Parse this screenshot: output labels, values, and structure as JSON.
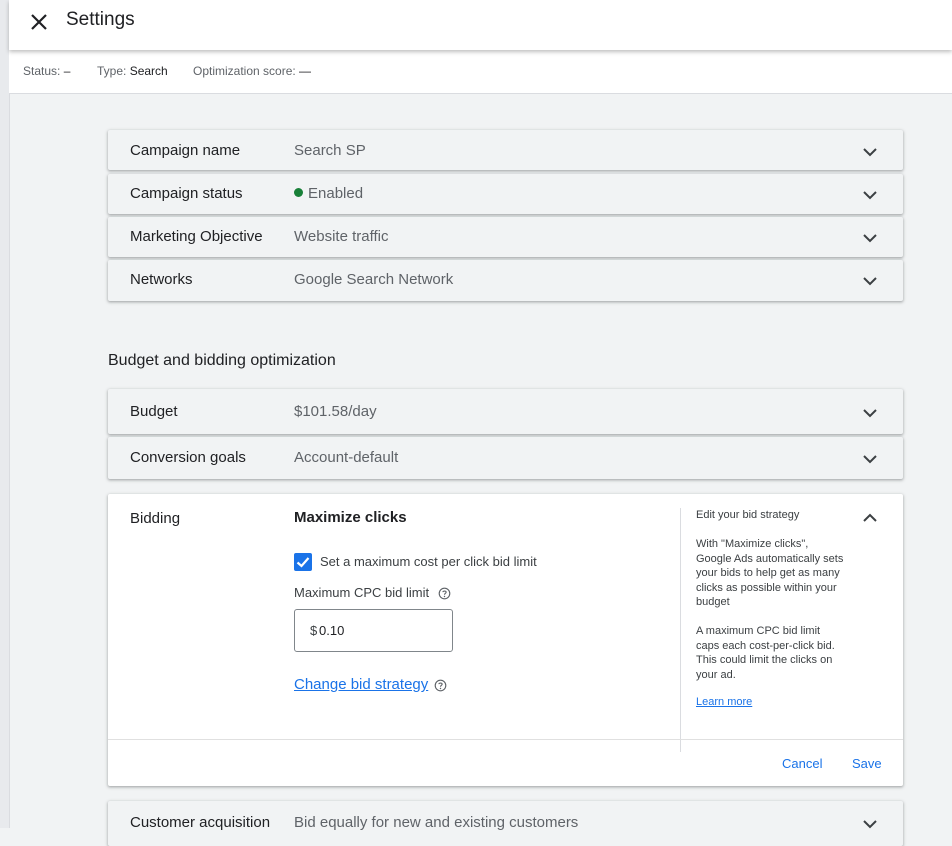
{
  "header": {
    "title": "Settings"
  },
  "status_bar": {
    "status_label": "Status:",
    "status_value": "–",
    "type_label": "Type:",
    "type_value": "Search",
    "opt_label": "Optimization score:",
    "opt_value": "—"
  },
  "campaign_rows": [
    {
      "label": "Campaign name",
      "value": "Search SP"
    },
    {
      "label": "Campaign status",
      "value": "Enabled",
      "status_color": "#188038"
    },
    {
      "label": "Marketing Objective",
      "value": "Website traffic"
    },
    {
      "label": "Networks",
      "value": "Google Search Network"
    }
  ],
  "budget_section": {
    "title": "Budget and bidding optimization",
    "budget": {
      "label": "Budget",
      "value": "$101.58/day"
    },
    "conversion": {
      "label": "Conversion goals",
      "value": "Account-default"
    }
  },
  "bidding": {
    "label": "Bidding",
    "strategy": "Maximize clicks",
    "checkbox_label": "Set a maximum cost per click bid limit",
    "checkbox_checked": true,
    "cpc_label": "Maximum CPC bid limit",
    "currency": "$",
    "cpc_value": "0.10",
    "change_link": "Change bid strategy",
    "help": {
      "title": "Edit your bid strategy",
      "p1": "With \"Maximize clicks\", Google Ads automatically sets your bids to help get as many clicks as possible within your budget",
      "p2": "A maximum CPC bid limit caps each cost-per-click bid. This could limit the clicks on your ad.",
      "learn_more": "Learn more"
    },
    "cancel": "Cancel",
    "save": "Save"
  },
  "customer_acquisition": {
    "label": "Customer acquisition",
    "value": "Bid equally for new and existing customers"
  },
  "colors": {
    "accent": "#1a73e8",
    "enabled": "#188038"
  },
  "icons": [
    "close-icon",
    "chevron-down-icon",
    "chevron-up-icon",
    "help-icon",
    "check-icon"
  ]
}
